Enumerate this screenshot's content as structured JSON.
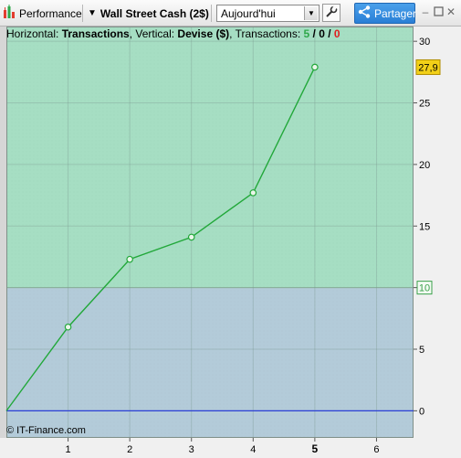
{
  "toolbar": {
    "performance_label": "Performance",
    "instrument_title": "Wall Street Cash (2$)",
    "period_value": "Aujourd'hui",
    "share_label": "Partager"
  },
  "legend": {
    "horizontal_prefix": "Horizontal: ",
    "horizontal_value": "Transactions",
    "vertical_prefix": ", Vertical: ",
    "vertical_value": "Devise ($)",
    "transactions_prefix": ", Transactions: ",
    "wins": "5",
    "slash1": " / ",
    "neutral": "0",
    "slash2": " / ",
    "losses": "0"
  },
  "copyright": "© IT-Finance.com",
  "colors": {
    "green_zone": "#a6dec3",
    "blue_zone": "#b3cbd9",
    "line": "#22a83a",
    "zero_line": "#2a3fd6",
    "last_value_badge": "#f2d018",
    "level_badge_text": "#3aa04a",
    "share_button": "#2e86db"
  },
  "icons": {
    "performance": "bar-chart-icon",
    "settings": "wrench-icon",
    "share": "share-icon",
    "minimize": "minimize-icon",
    "restore": "restore-icon",
    "close": "close-icon"
  },
  "chart_data": {
    "type": "line",
    "x": [
      0,
      1,
      2,
      3,
      4,
      5
    ],
    "series": [
      {
        "values": [
          0,
          6.8,
          12.3,
          14.1,
          17.7,
          27.9
        ]
      }
    ],
    "xlim": [
      0,
      6.6
    ],
    "ylim": [
      -2.2,
      31.2
    ],
    "x_ticks": [
      "1",
      "2",
      "3",
      "4",
      "5",
      "6"
    ],
    "highlighted_x_tick": "5",
    "y_ticks": [
      "0",
      "5",
      "10",
      "15",
      "20",
      "25",
      "30"
    ],
    "zone_threshold": 10,
    "zone_threshold_label": "10",
    "last_value_label": "27,9",
    "grid": true
  }
}
